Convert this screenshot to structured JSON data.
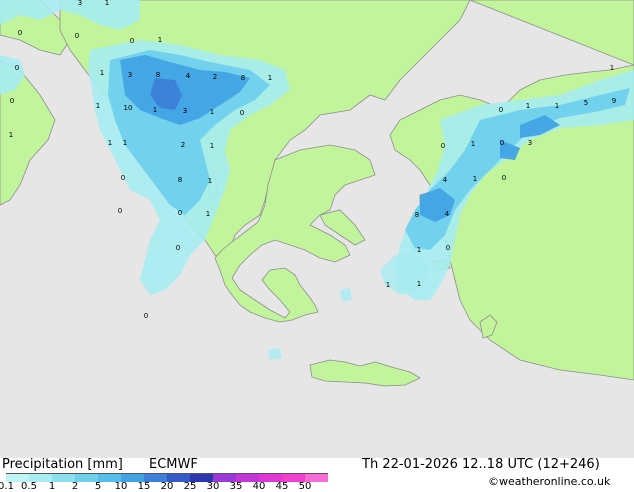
{
  "footer": {
    "title": "Precipitation [mm]",
    "model": "ECMWF",
    "valid_time": "Th 22-01-2026 12..18 UTC (12+246)",
    "credit": "©weatheronline.co.uk"
  },
  "scale": {
    "labels": [
      "0.1",
      "0.5",
      "1",
      "2",
      "5",
      "10",
      "15",
      "20",
      "25",
      "30",
      "35",
      "40",
      "45",
      "50"
    ],
    "colors": [
      "#bff5f5",
      "#a6ecf2",
      "#8ae0ee",
      "#6fd0ec",
      "#55bde8",
      "#41a3e4",
      "#3c80d8",
      "#3459c8",
      "#2b38b0",
      "#9a38d8",
      "#c137d8",
      "#de37d4",
      "#f23fd0",
      "#f66bd8"
    ]
  },
  "colors": {
    "sea": "#e6e6e6",
    "land": "#c2f59b",
    "coast": "#8d8d8d"
  },
  "map_values": [
    "3",
    "1",
    "0",
    "0",
    "0",
    "1",
    "0",
    "1",
    "3",
    "8",
    "4",
    "2",
    "8",
    "1",
    "10",
    "1",
    "3",
    "1",
    "0",
    "1",
    "1",
    "2",
    "1",
    "0",
    "8",
    "1",
    "0",
    "1",
    "0",
    "0",
    "0",
    "0",
    "1",
    "9",
    "1",
    "1",
    "5",
    "0",
    "0",
    "1",
    "4",
    "1",
    "0",
    "8",
    "4",
    "1",
    "0",
    "1",
    "1",
    "3",
    "0",
    "1",
    "1"
  ]
}
